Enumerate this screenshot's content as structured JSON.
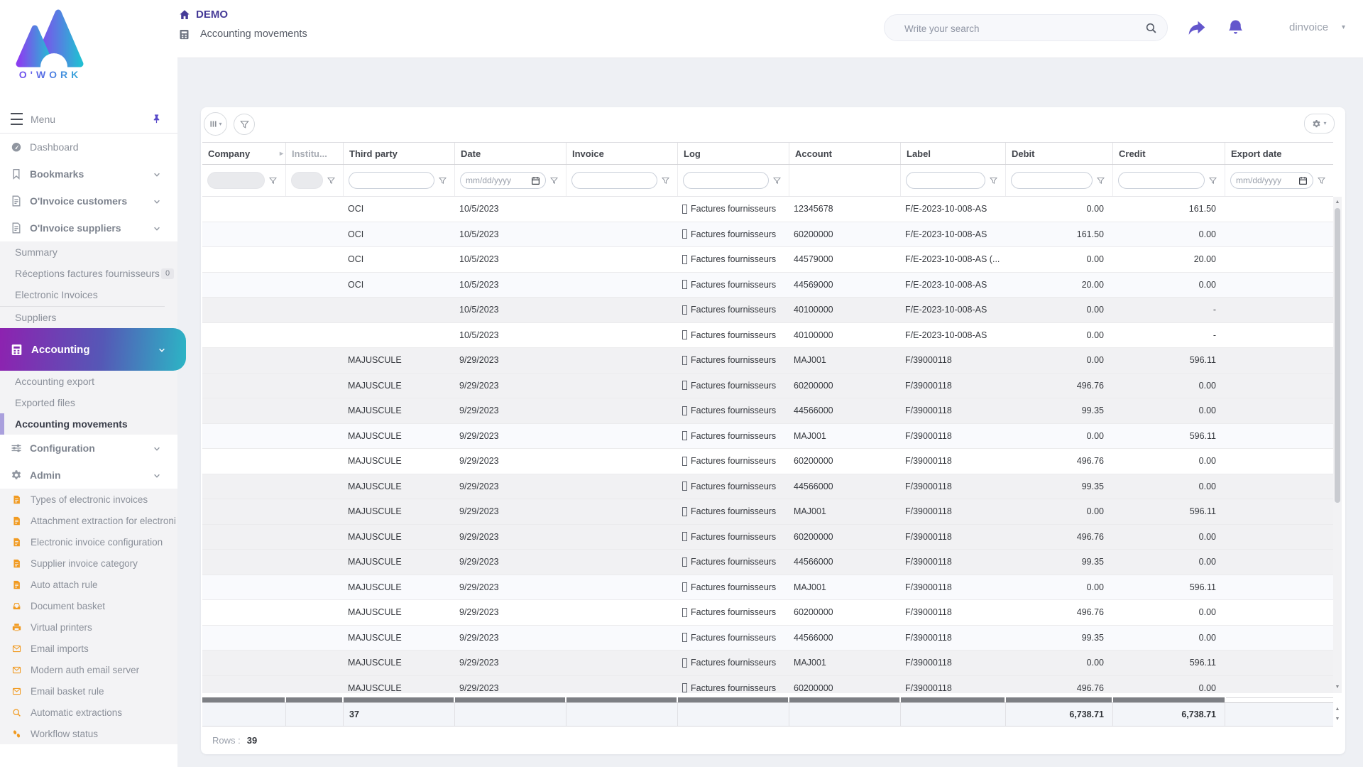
{
  "app": {
    "name": "O'WORK"
  },
  "colors": {
    "accent": "#5b4dbe",
    "brand_gradient_from": "#8d22b0",
    "brand_gradient_to": "#2cb5c5",
    "icon_orange": "#f19a20",
    "demo_purple": "#453a97"
  },
  "icons": {
    "header": [
      "home-icon",
      "calculator-icon",
      "search-icon",
      "share-icon",
      "bell-icon",
      "caret-down-icon"
    ],
    "sidebar": [
      "hamburger-icon",
      "pin-icon",
      "gauge-icon",
      "bookmark-icon",
      "invoice-icon",
      "calculator-icon",
      "sliders-icon",
      "gear-icon",
      "document-icon",
      "inbox-icon",
      "printer-icon",
      "envelope-icon",
      "magnifier-icon",
      "footsteps-icon"
    ],
    "toolbar": [
      "columns-icon",
      "funnel-icon",
      "gear-icon"
    ],
    "grid": [
      "funnel-icon",
      "calendar-icon",
      "resize-arrow-icon",
      "missing-glyph-icon",
      "scroll-arrow-icons"
    ]
  },
  "header": {
    "breadcrumb": {
      "root": "DEMO",
      "page": "Accounting movements"
    },
    "search_placeholder": "Write your search",
    "username": "dinvoice"
  },
  "sidebar": {
    "menu_label": "Menu",
    "items": [
      {
        "style": "item",
        "icon": "gauge",
        "label": "Dashboard"
      },
      {
        "style": "item-bold",
        "icon": "bookmark",
        "label": "Bookmarks",
        "chevron": true
      },
      {
        "style": "item-bold",
        "icon": "doc",
        "label": "O'Invoice customers",
        "chevron": true
      },
      {
        "style": "item-bold",
        "icon": "doc",
        "label": "O'Invoice suppliers",
        "chevron": true
      },
      {
        "style": "sub",
        "label": "Summary"
      },
      {
        "style": "sub",
        "label": "Réceptions factures fournisseurs",
        "badge": "0"
      },
      {
        "style": "sub",
        "label": "Electronic Invoices",
        "divider_after": true
      },
      {
        "style": "sub",
        "label": "Suppliers"
      },
      {
        "style": "gradient",
        "icon": "calc",
        "label": "Accounting",
        "chevron": true
      },
      {
        "style": "sub",
        "label": "Accounting export"
      },
      {
        "style": "sub",
        "label": "Exported files"
      },
      {
        "style": "sub-active",
        "label": "Accounting movements"
      },
      {
        "style": "item-bold",
        "icon": "sliders",
        "label": "Configuration",
        "chevron": true
      },
      {
        "style": "item-bold",
        "icon": "gear",
        "label": "Admin",
        "chevron": true
      },
      {
        "style": "sub-orange",
        "icon": "docfill",
        "label": "Types of electronic invoices"
      },
      {
        "style": "sub-orange",
        "icon": "docfill",
        "label": "Attachment extraction for electroni"
      },
      {
        "style": "sub-orange",
        "icon": "docfill",
        "label": "Electronic invoice configuration"
      },
      {
        "style": "sub-orange",
        "icon": "docfill",
        "label": "Supplier invoice category"
      },
      {
        "style": "sub-orange",
        "icon": "docfill",
        "label": "Auto attach rule"
      },
      {
        "style": "sub-orange",
        "icon": "inbox",
        "label": "Document basket"
      },
      {
        "style": "sub-orange",
        "icon": "printer",
        "label": "Virtual printers"
      },
      {
        "style": "sub-orange",
        "icon": "mail",
        "label": "Email imports"
      },
      {
        "style": "sub-orange",
        "icon": "mail",
        "label": "Modern auth email server"
      },
      {
        "style": "sub-orange",
        "icon": "mail",
        "label": "Email basket rule"
      },
      {
        "style": "sub-orange",
        "icon": "mag",
        "label": "Automatic extractions"
      },
      {
        "style": "sub-orange",
        "icon": "steps",
        "label": "Workflow status"
      }
    ]
  },
  "grid": {
    "columns": [
      {
        "field": "company",
        "label": "Company",
        "filter": "disabled",
        "trailing_arrow": true
      },
      {
        "field": "institution",
        "label": "Institu...",
        "filter": "disabled",
        "muted": true
      },
      {
        "field": "third_party",
        "label": "Third party",
        "filter": "text"
      },
      {
        "field": "date",
        "label": "Date",
        "filter": "date",
        "placeholder": "mm/dd/yyyy"
      },
      {
        "field": "invoice",
        "label": "Invoice",
        "filter": "text"
      },
      {
        "field": "log",
        "label": "Log",
        "filter": "text"
      },
      {
        "field": "account",
        "label": "Account",
        "filter": "none"
      },
      {
        "field": "label",
        "label": "Label",
        "filter": "text"
      },
      {
        "field": "debit",
        "label": "Debit",
        "filter": "text",
        "align": "right"
      },
      {
        "field": "credit",
        "label": "Credit",
        "filter": "text",
        "align": "right"
      },
      {
        "field": "export_date",
        "label": "Export date",
        "filter": "date",
        "placeholder": "mm/dd/yyyy"
      }
    ],
    "log_text": "Factures fournisseurs",
    "rows": [
      {
        "third_party": "OCI",
        "date": "10/5/2023",
        "log": "Factures fournisseurs",
        "account": "12345678",
        "label": "F/E-2023-10-008-AS",
        "debit": "0.00",
        "credit": "161.50",
        "shade": "a"
      },
      {
        "third_party": "OCI",
        "date": "10/5/2023",
        "log": "Factures fournisseurs",
        "account": "60200000",
        "label": "F/E-2023-10-008-AS",
        "debit": "161.50",
        "credit": "0.00",
        "shade": "b"
      },
      {
        "third_party": "OCI",
        "date": "10/5/2023",
        "log": "Factures fournisseurs",
        "account": "44579000",
        "label": "F/E-2023-10-008-AS (...",
        "debit": "0.00",
        "credit": "20.00",
        "shade": "a"
      },
      {
        "third_party": "OCI",
        "date": "10/5/2023",
        "log": "Factures fournisseurs",
        "account": "44569000",
        "label": "F/E-2023-10-008-AS",
        "debit": "20.00",
        "credit": "0.00",
        "shade": "b"
      },
      {
        "third_party": "",
        "date": "10/5/2023",
        "log": "Factures fournisseurs",
        "account": "40100000",
        "label": "F/E-2023-10-008-AS",
        "debit": "0.00",
        "credit": "-",
        "shade": "c"
      },
      {
        "third_party": "",
        "date": "10/5/2023",
        "log": "Factures fournisseurs",
        "account": "40100000",
        "label": "F/E-2023-10-008-AS",
        "debit": "0.00",
        "credit": "-",
        "shade": "a"
      },
      {
        "third_party": "MAJUSCULE",
        "date": "9/29/2023",
        "log": "Factures fournisseurs",
        "account": "MAJ001",
        "label": "F/39000118",
        "debit": "0.00",
        "credit": "596.11",
        "shade": "c"
      },
      {
        "third_party": "MAJUSCULE",
        "date": "9/29/2023",
        "log": "Factures fournisseurs",
        "account": "60200000",
        "label": "F/39000118",
        "debit": "496.76",
        "credit": "0.00",
        "shade": "c"
      },
      {
        "third_party": "MAJUSCULE",
        "date": "9/29/2023",
        "log": "Factures fournisseurs",
        "account": "44566000",
        "label": "F/39000118",
        "debit": "99.35",
        "credit": "0.00",
        "shade": "c"
      },
      {
        "third_party": "MAJUSCULE",
        "date": "9/29/2023",
        "log": "Factures fournisseurs",
        "account": "MAJ001",
        "label": "F/39000118",
        "debit": "0.00",
        "credit": "596.11",
        "shade": "b"
      },
      {
        "third_party": "MAJUSCULE",
        "date": "9/29/2023",
        "log": "Factures fournisseurs",
        "account": "60200000",
        "label": "F/39000118",
        "debit": "496.76",
        "credit": "0.00",
        "shade": "a"
      },
      {
        "third_party": "MAJUSCULE",
        "date": "9/29/2023",
        "log": "Factures fournisseurs",
        "account": "44566000",
        "label": "F/39000118",
        "debit": "99.35",
        "credit": "0.00",
        "shade": "c"
      },
      {
        "third_party": "MAJUSCULE",
        "date": "9/29/2023",
        "log": "Factures fournisseurs",
        "account": "MAJ001",
        "label": "F/39000118",
        "debit": "0.00",
        "credit": "596.11",
        "shade": "c"
      },
      {
        "third_party": "MAJUSCULE",
        "date": "9/29/2023",
        "log": "Factures fournisseurs",
        "account": "60200000",
        "label": "F/39000118",
        "debit": "496.76",
        "credit": "0.00",
        "shade": "c"
      },
      {
        "third_party": "MAJUSCULE",
        "date": "9/29/2023",
        "log": "Factures fournisseurs",
        "account": "44566000",
        "label": "F/39000118",
        "debit": "99.35",
        "credit": "0.00",
        "shade": "c"
      },
      {
        "third_party": "MAJUSCULE",
        "date": "9/29/2023",
        "log": "Factures fournisseurs",
        "account": "MAJ001",
        "label": "F/39000118",
        "debit": "0.00",
        "credit": "596.11",
        "shade": "b"
      },
      {
        "third_party": "MAJUSCULE",
        "date": "9/29/2023",
        "log": "Factures fournisseurs",
        "account": "60200000",
        "label": "F/39000118",
        "debit": "496.76",
        "credit": "0.00",
        "shade": "a"
      },
      {
        "third_party": "MAJUSCULE",
        "date": "9/29/2023",
        "log": "Factures fournisseurs",
        "account": "44566000",
        "label": "F/39000118",
        "debit": "99.35",
        "credit": "0.00",
        "shade": "b"
      },
      {
        "third_party": "MAJUSCULE",
        "date": "9/29/2023",
        "log": "Factures fournisseurs",
        "account": "MAJ001",
        "label": "F/39000118",
        "debit": "0.00",
        "credit": "596.11",
        "shade": "c"
      },
      {
        "third_party": "MAJUSCULE",
        "date": "9/29/2023",
        "log": "Factures fournisseurs",
        "account": "60200000",
        "label": "F/39000118",
        "debit": "496.76",
        "credit": "0.00",
        "shade": "c"
      }
    ],
    "totals": {
      "third_party": "37",
      "debit": "6,738.71",
      "credit": "6,738.71"
    },
    "footer": {
      "label": "Rows :",
      "count": "39"
    }
  }
}
